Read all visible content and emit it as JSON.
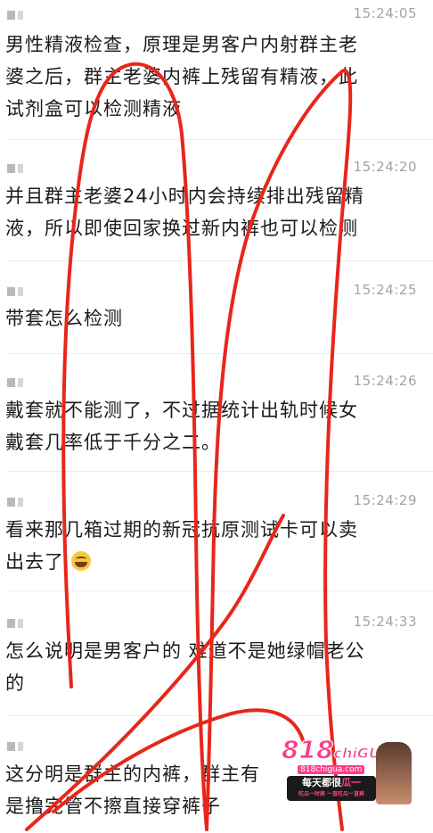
{
  "messages": [
    {
      "time": "15:24:05",
      "lines": [
        "男性精液检查，原理是男客户内射群主老",
        "婆之后，群主老婆内裤上残留有精液，此",
        "试剂盒可以检测精液"
      ]
    },
    {
      "time": "15:24:20",
      "lines": [
        "并且群主老婆24小时内会持续排出残留精",
        "液，所以即使回家换过新内裤也可以检测"
      ]
    },
    {
      "time": "15:24:25",
      "lines": [
        "带套怎么检测"
      ]
    },
    {
      "time": "15:24:26",
      "lines": [
        "戴套就不能测了，不过据统计出轨时候女",
        "戴套几率低于千分之二。"
      ]
    },
    {
      "time": "15:24:29",
      "lines": [
        "看来那几箱过期的新冠抗原测试卡可以卖",
        "出去了"
      ],
      "emoji": "laughing-crying-emoji"
    },
    {
      "time": "15:24:33",
      "lines": [
        "怎么说明是男客户的 难道不是她绿帽老公",
        "的"
      ]
    },
    {
      "time": "",
      "lines": [
        "这分明是群主的内裤，群主有",
        "是撸完管不擦直接穿裤子"
      ]
    }
  ],
  "watermark": {
    "logo": "818",
    "logo_suffix": "chiGUA",
    "url": "818chigua.com",
    "slogan_prefix": "每天都很",
    "slogan_highlight": "瓜一",
    "subtext": "吃瓜一时爽 一直吃瓜一直爽"
  },
  "colors": {
    "scribble": "#e8261a",
    "time": "#a3a3a3",
    "text": "#1b1b1b",
    "watermark_pink": "#ff3d8b"
  }
}
